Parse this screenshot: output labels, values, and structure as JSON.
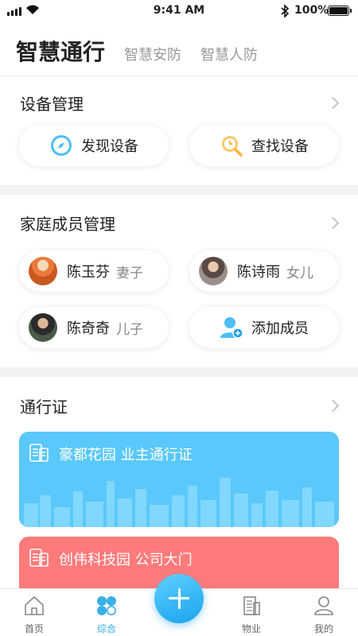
{
  "status_bar": {
    "time": "9:41 AM",
    "battery": "100%"
  },
  "header": {
    "tabs": [
      {
        "label": "智慧通行",
        "active": true
      },
      {
        "label": "智慧安防",
        "active": false
      },
      {
        "label": "智慧人防",
        "active": false
      }
    ]
  },
  "devices": {
    "title": "设备管理",
    "discover_label": "发现设备",
    "find_label": "查找设备"
  },
  "family": {
    "title": "家庭成员管理",
    "members": [
      {
        "name": "陈玉芬",
        "relation": "妻子"
      },
      {
        "name": "陈诗雨",
        "relation": "女儿"
      },
      {
        "name": "陈奇奇",
        "relation": "儿子"
      }
    ],
    "add_label": "添加成员"
  },
  "passes": {
    "title": "通行证",
    "cards": [
      {
        "label": "豪都花园 业主通行证",
        "color": "#5ac8fa"
      },
      {
        "label": "创伟科技园 公司大门",
        "color": "#ff7a7a"
      }
    ]
  },
  "bottom_nav": {
    "items": [
      {
        "label": "首页",
        "icon": "home-icon"
      },
      {
        "label": "综合",
        "icon": "grid-icon",
        "active": true
      },
      {
        "label": "物业",
        "icon": "building-icon"
      },
      {
        "label": "我的",
        "icon": "user-icon"
      }
    ],
    "fab_icon": "plus-icon"
  },
  "colors": {
    "accent": "#3ab0e8",
    "blue_card": "#5ac8fa",
    "red_card": "#ff7a7a"
  }
}
